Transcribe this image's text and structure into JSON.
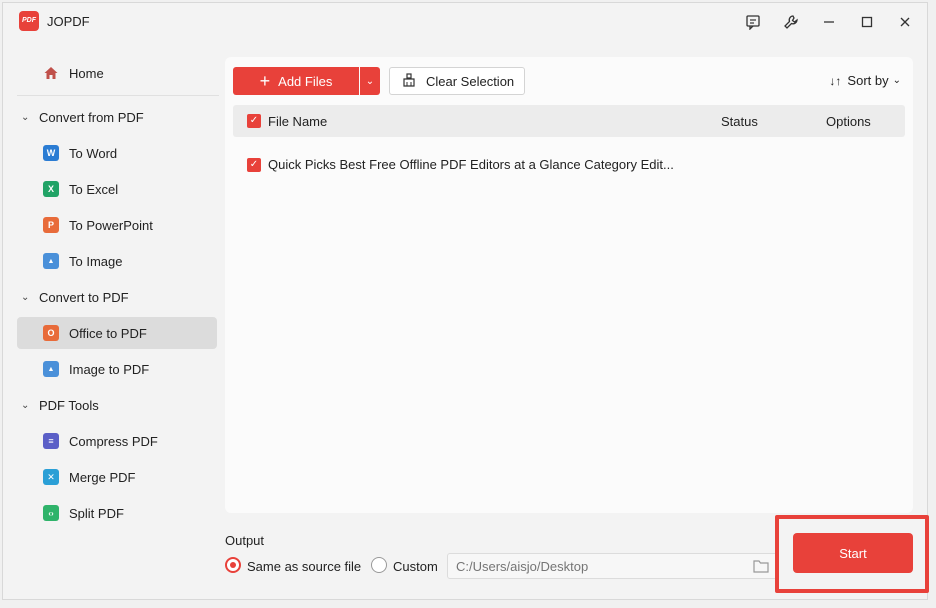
{
  "app": {
    "title": "JOPDF",
    "logo_text": "PDF"
  },
  "titlebar": {
    "icons": [
      "feedback-icon",
      "wrench-icon",
      "minimize-icon",
      "maximize-icon",
      "close-icon"
    ]
  },
  "sidebar": {
    "home": {
      "label": "Home",
      "icon": "home-icon"
    },
    "sections": [
      {
        "label": "Convert from PDF",
        "items": [
          {
            "label": "To Word",
            "icon": "word-icon",
            "glyph": "W",
            "color": "#2b7cd3"
          },
          {
            "label": "To Excel",
            "icon": "excel-icon",
            "glyph": "X",
            "color": "#21a366"
          },
          {
            "label": "To PowerPoint",
            "icon": "powerpoint-icon",
            "glyph": "P",
            "color": "#e86b3a"
          },
          {
            "label": "To Image",
            "icon": "image-icon",
            "glyph": "▲",
            "color": "#4a90d9"
          }
        ]
      },
      {
        "label": "Convert to PDF",
        "items": [
          {
            "label": "Office to PDF",
            "icon": "office-icon",
            "glyph": "O",
            "color": "#e86b3a",
            "active": true
          },
          {
            "label": "Image to PDF",
            "icon": "image-icon",
            "glyph": "▲",
            "color": "#4a90d9"
          }
        ]
      },
      {
        "label": "PDF Tools",
        "items": [
          {
            "label": "Compress PDF",
            "icon": "compress-icon",
            "glyph": "≡",
            "color": "#5b5fc7"
          },
          {
            "label": "Merge PDF",
            "icon": "merge-icon",
            "glyph": "✕",
            "color": "#2a9fd6"
          },
          {
            "label": "Split PDF",
            "icon": "split-icon",
            "glyph": "‹›",
            "color": "#2fb36a"
          }
        ]
      }
    ]
  },
  "toolbar": {
    "add_files": "Add Files",
    "clear_selection": "Clear Selection",
    "sort_by": "Sort by"
  },
  "table": {
    "columns": {
      "name": "File Name",
      "status": "Status",
      "options": "Options"
    },
    "rows": [
      {
        "name": "Quick Picks Best Free Offline PDF Editors at a Glance Category Edit...",
        "checked": true
      }
    ]
  },
  "output": {
    "label": "Output",
    "same_as_source": "Same as source file",
    "custom": "Custom",
    "path_placeholder": "C:/Users/aisjo/Desktop",
    "selected": "same_as_source"
  },
  "start_label": "Start",
  "colors": {
    "accent": "#e8413a"
  }
}
